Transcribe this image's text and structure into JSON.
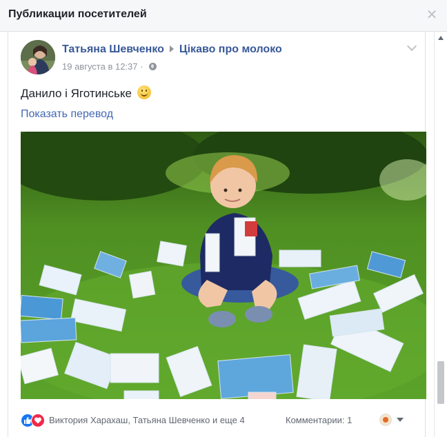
{
  "dialog": {
    "title": "Публикации посетителей",
    "close_icon": "close-icon"
  },
  "post": {
    "author": "Татьяна Шевченко",
    "target_page": "Цікаво про молоко",
    "timestamp": "19 августа в 12:37",
    "separator": "·",
    "privacy_icon": "globe-icon",
    "text": "Данило і Яготинське",
    "translate_label": "Показать перевод",
    "reactors": "Виктория Харахаш, Татьяна Шевченко и еще 4",
    "comments": "Комментарии: 1"
  },
  "colors": {
    "link": "#385898",
    "accent": "#4267b2",
    "meta": "#90949c",
    "like": "#1877f2",
    "love": "#f0284a"
  }
}
